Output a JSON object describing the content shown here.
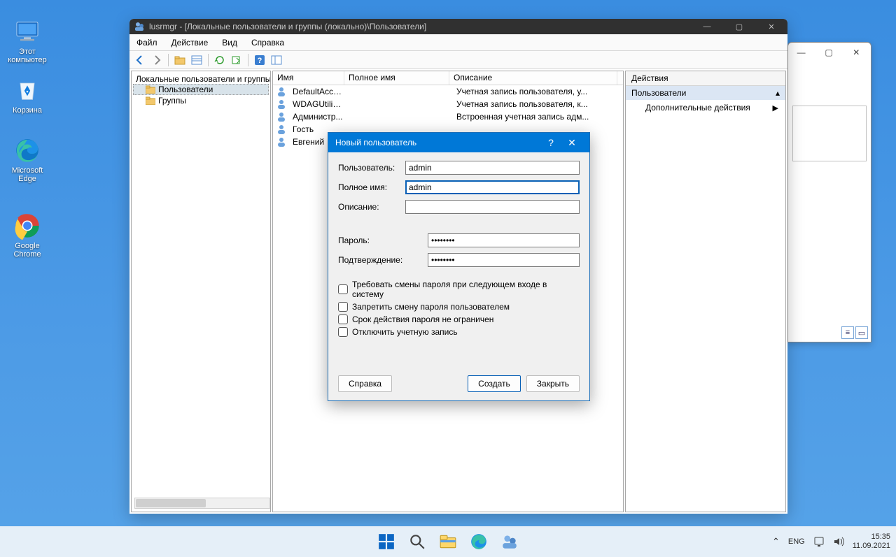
{
  "desktop": {
    "items": [
      {
        "label": "Этот\nкомпьютер"
      },
      {
        "label": "Корзина"
      },
      {
        "label": "Microsoft\nEdge"
      },
      {
        "label": "Google\nChrome"
      }
    ]
  },
  "bgwin": {
    "min": "—",
    "max": "▢",
    "close": "✕"
  },
  "mmc": {
    "title": "lusrmgr - [Локальные пользователи и группы (локально)\\Пользователи]",
    "menu": [
      "Файл",
      "Действие",
      "Вид",
      "Справка"
    ],
    "tree": {
      "root": "Локальные пользователи и группы",
      "items": [
        "Пользователи",
        "Группы"
      ]
    },
    "columns": {
      "name": "Имя",
      "full": "Полное имя",
      "desc": "Описание"
    },
    "rows": [
      {
        "name": "DefaultAcco...",
        "full": "",
        "desc": "Учетная запись пользователя, у..."
      },
      {
        "name": "WDAGUtility...",
        "full": "",
        "desc": "Учетная запись пользователя, к..."
      },
      {
        "name": "Администр...",
        "full": "",
        "desc": "Встроенная учетная запись адм..."
      },
      {
        "name": "Гость",
        "full": "",
        "desc": ""
      },
      {
        "name": "Евгений",
        "full": "",
        "desc": ""
      }
    ],
    "actions": {
      "header": "Действия",
      "section": "Пользователи",
      "more": "Дополнительные действия"
    }
  },
  "dialog": {
    "title": "Новый пользователь",
    "labels": {
      "user": "Пользователь:",
      "full": "Полное имя:",
      "desc": "Описание:",
      "pw": "Пароль:",
      "pw2": "Подтверждение:"
    },
    "values": {
      "user": "admin",
      "full": "admin",
      "desc": "",
      "pw": "••••••••",
      "pw2": "••••••••"
    },
    "checks": [
      "Требовать смены пароля при следующем входе в систему",
      "Запретить смену пароля пользователем",
      "Срок действия пароля не ограничен",
      "Отключить учетную запись"
    ],
    "buttons": {
      "help": "Справка",
      "create": "Создать",
      "close": "Закрыть"
    }
  },
  "taskbar": {
    "lang": "ENG",
    "time": "15:35",
    "date": "11.09.2021"
  }
}
